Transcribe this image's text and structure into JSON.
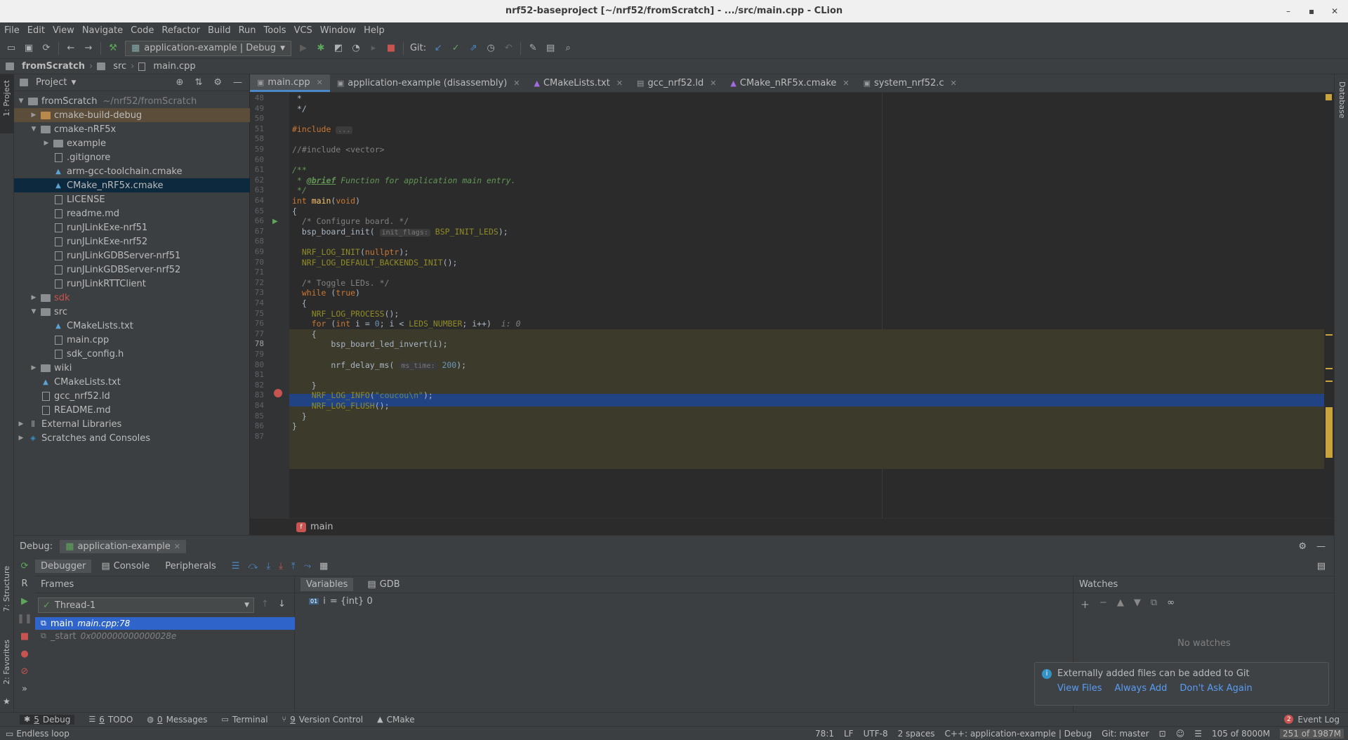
{
  "window": {
    "title": "nrf52-baseproject [~/nrf52/fromScratch] - .../src/main.cpp - CLion"
  },
  "menu": [
    "File",
    "Edit",
    "View",
    "Navigate",
    "Code",
    "Refactor",
    "Build",
    "Run",
    "Tools",
    "VCS",
    "Window",
    "Help"
  ],
  "toolbar": {
    "run_config": "application-example | Debug",
    "git_label": "Git:"
  },
  "breadcrumb": {
    "project": "fromScratch",
    "folder": "src",
    "file": "main.cpp"
  },
  "project_panel": {
    "title": "Project",
    "tree": [
      {
        "label": "fromScratch",
        "suffix": "~/nrf52/fromScratch",
        "depth": 0,
        "arrow": "down",
        "icon": "folder"
      },
      {
        "label": "cmake-build-debug",
        "depth": 1,
        "arrow": "right",
        "icon": "folder-orange",
        "highlight": true
      },
      {
        "label": "cmake-nRF5x",
        "depth": 1,
        "arrow": "down",
        "icon": "folder"
      },
      {
        "label": "example",
        "depth": 2,
        "arrow": "right",
        "icon": "folder"
      },
      {
        "label": ".gitignore",
        "depth": 2,
        "icon": "file"
      },
      {
        "label": "arm-gcc-toolchain.cmake",
        "depth": 2,
        "icon": "cmake"
      },
      {
        "label": "CMake_nRF5x.cmake",
        "depth": 2,
        "icon": "cmake",
        "selected": true
      },
      {
        "label": "LICENSE",
        "depth": 2,
        "icon": "file"
      },
      {
        "label": "readme.md",
        "depth": 2,
        "icon": "file"
      },
      {
        "label": "runJLinkExe-nrf51",
        "depth": 2,
        "icon": "file"
      },
      {
        "label": "runJLinkExe-nrf52",
        "depth": 2,
        "icon": "file"
      },
      {
        "label": "runJLinkGDBServer-nrf51",
        "depth": 2,
        "icon": "file"
      },
      {
        "label": "runJLinkGDBServer-nrf52",
        "depth": 2,
        "icon": "file"
      },
      {
        "label": "runJLinkRTTClient",
        "depth": 2,
        "icon": "file"
      },
      {
        "label": "sdk",
        "depth": 1,
        "arrow": "right",
        "icon": "folder",
        "red": true
      },
      {
        "label": "src",
        "depth": 1,
        "arrow": "down",
        "icon": "folder"
      },
      {
        "label": "CMakeLists.txt",
        "depth": 2,
        "icon": "cmake"
      },
      {
        "label": "main.cpp",
        "depth": 2,
        "icon": "file"
      },
      {
        "label": "sdk_config.h",
        "depth": 2,
        "icon": "file"
      },
      {
        "label": "wiki",
        "depth": 1,
        "arrow": "right",
        "icon": "folder"
      },
      {
        "label": "CMakeLists.txt",
        "depth": 1,
        "icon": "cmake"
      },
      {
        "label": "gcc_nrf52.ld",
        "depth": 1,
        "icon": "file"
      },
      {
        "label": "README.md",
        "depth": 1,
        "icon": "file"
      },
      {
        "label": "External Libraries",
        "depth": 0,
        "arrow": "right",
        "icon": "lib"
      },
      {
        "label": "Scratches and Consoles",
        "depth": 0,
        "arrow": "right",
        "icon": "scratch"
      }
    ]
  },
  "editor_tabs": [
    {
      "label": "main.cpp",
      "active": true
    },
    {
      "label": "application-example (disassembly)"
    },
    {
      "label": "CMakeLists.txt"
    },
    {
      "label": "gcc_nrf52.ld"
    },
    {
      "label": "CMake_nRF5x.cmake"
    },
    {
      "label": "system_nrf52.c"
    }
  ],
  "code_lines": [
    {
      "n": "48",
      "html": " *"
    },
    {
      "n": "49",
      "html": " */"
    },
    {
      "n": "50",
      "html": ""
    },
    {
      "n": "51",
      "html": "<span class='kw'>#include</span> <span class='hint'>...</span>"
    },
    {
      "n": "58",
      "html": ""
    },
    {
      "n": "59",
      "html": "<span class='cmt'>//#include &lt;vector&gt;</span>"
    },
    {
      "n": "60",
      "html": ""
    },
    {
      "n": "61",
      "html": "<span class='doc'>/**</span>"
    },
    {
      "n": "62",
      "html": "<span class='doc'> * <b><u>@brief</u></b> Function for application main entry.</span>"
    },
    {
      "n": "63",
      "html": "<span class='doc'> */</span>"
    },
    {
      "n": "64",
      "html": "<span class='kw'>int</span> <span class='fn'>main</span>(<span class='kw'>void</span>)"
    },
    {
      "n": "65",
      "html": "{"
    },
    {
      "n": "66",
      "html": "  <span class='cmt'>/* Configure board. */</span>"
    },
    {
      "n": "67",
      "html": "  bsp_board_init( <span class='hint'>init_flags:</span> <span class='mac'>BSP_INIT_LEDS</span>);"
    },
    {
      "n": "68",
      "html": ""
    },
    {
      "n": "69",
      "html": "  <span class='mac'>NRF_LOG_INIT</span>(<span class='kw'>nullptr</span>);"
    },
    {
      "n": "70",
      "html": "  <span class='mac'>NRF_LOG_DEFAULT_BACKENDS_INIT</span>();"
    },
    {
      "n": "71",
      "html": ""
    },
    {
      "n": "72",
      "html": "  <span class='cmt'>/* Toggle LEDs. */</span>"
    },
    {
      "n": "73",
      "html": "  <span class='kw'>while</span> (<span class='kw'>true</span>)"
    },
    {
      "n": "74",
      "html": "  {"
    },
    {
      "n": "75",
      "html": "    <span class='mac'>NRF_LOG_PROCESS</span>();"
    },
    {
      "n": "76",
      "html": "    <span class='kw'>for</span> (<span class='kw'>int</span> i = <span class='num'>0</span>; i &lt; <span class='mac'>LEDS_NUMBER</span>; i++)  <span class='cmt' style='font-style:italic'>i: 0</span>"
    },
    {
      "n": "77",
      "html": "    {"
    },
    {
      "n": "78",
      "html": "        bsp_board_led_invert(i);"
    },
    {
      "n": "79",
      "html": ""
    },
    {
      "n": "80",
      "html": "        nrf_delay_ms( <span class='hint'>ms_time:</span> <span class='num'>200</span>);"
    },
    {
      "n": "81",
      "html": ""
    },
    {
      "n": "82",
      "html": "    }"
    },
    {
      "n": "83",
      "html": "    <span class='mac'>NRF_LOG_INFO</span>(<span class='str'>\"coucou\\n\"</span>);"
    },
    {
      "n": "84",
      "html": "    <span class='mac'>NRF_LOG_FLUSH</span>();"
    },
    {
      "n": "85",
      "html": "  }"
    },
    {
      "n": "86",
      "html": "}"
    },
    {
      "n": "87",
      "html": ""
    }
  ],
  "editor_breadcrumb": "main",
  "debug": {
    "label": "Debug:",
    "session": "application-example",
    "tabs": [
      "Debugger",
      "Console",
      "Peripherals"
    ],
    "frames_title": "Frames",
    "thread": "Thread-1",
    "frames": [
      {
        "name": "main",
        "loc": "main.cpp:78",
        "selected": true
      },
      {
        "name": "_start",
        "loc": "0x000000000000028e"
      }
    ],
    "vars_tabs": [
      "Variables",
      "GDB"
    ],
    "variables": [
      {
        "name": "i",
        "value": "= {int} 0"
      }
    ],
    "watches_title": "Watches",
    "watches_empty": "No watches"
  },
  "notification": {
    "message": "Externally added files can be added to Git",
    "actions": [
      "View Files",
      "Always Add",
      "Don't Ask Again"
    ]
  },
  "bottom_tabs": [
    {
      "num": "5",
      "label": "Debug",
      "active": true
    },
    {
      "num": "6",
      "label": "TODO"
    },
    {
      "num": "0",
      "label": "Messages"
    },
    {
      "num": "",
      "label": "Terminal"
    },
    {
      "num": "9",
      "label": "Version Control"
    },
    {
      "num": "",
      "label": "CMake"
    }
  ],
  "event_log": {
    "count": "2",
    "label": "Event Log"
  },
  "status": {
    "message": "Endless loop",
    "position": "78:1",
    "line_sep": "LF",
    "encoding": "UTF-8",
    "indent": "2 spaces",
    "context": "C++: application-example | Debug",
    "git": "Git: master",
    "memory1": "105 of 8000M",
    "memory2": "251 of 1987M"
  },
  "side_labels": {
    "project": "1: Project",
    "structure": "7: Structure",
    "favorites": "2: Favorites",
    "database": "Database"
  }
}
